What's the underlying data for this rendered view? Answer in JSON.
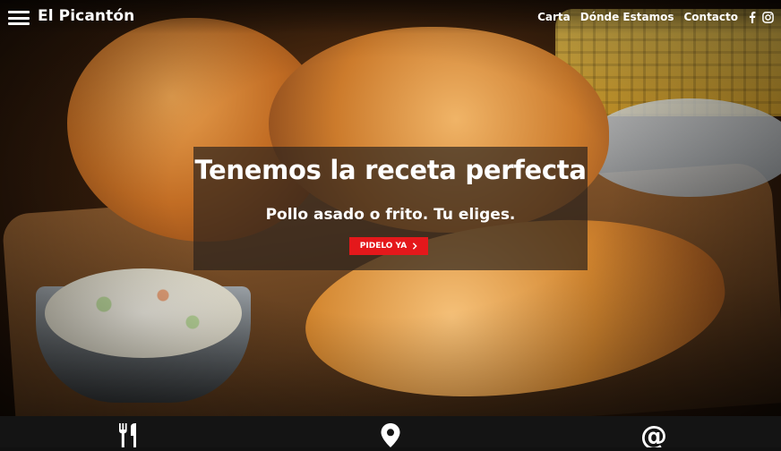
{
  "brand": {
    "name": "El Picantón"
  },
  "nav": {
    "items": [
      {
        "label": "Carta"
      },
      {
        "label": "Dónde Estamos"
      },
      {
        "label": "Contacto"
      }
    ],
    "social": [
      "facebook-icon",
      "instagram-icon"
    ]
  },
  "hero": {
    "title": "Tenemos la receta perfecta",
    "subtitle": "Pollo asado o frito. Tu eliges.",
    "cta_label": "PIDELO YA"
  },
  "bottom_icons": [
    "fork-knife-icon",
    "map-pin-icon",
    "at-sign-icon"
  ],
  "colors": {
    "accent": "#e4181b",
    "panel": "rgba(40,32,28,.68)",
    "bottom_bar": "#141414"
  }
}
